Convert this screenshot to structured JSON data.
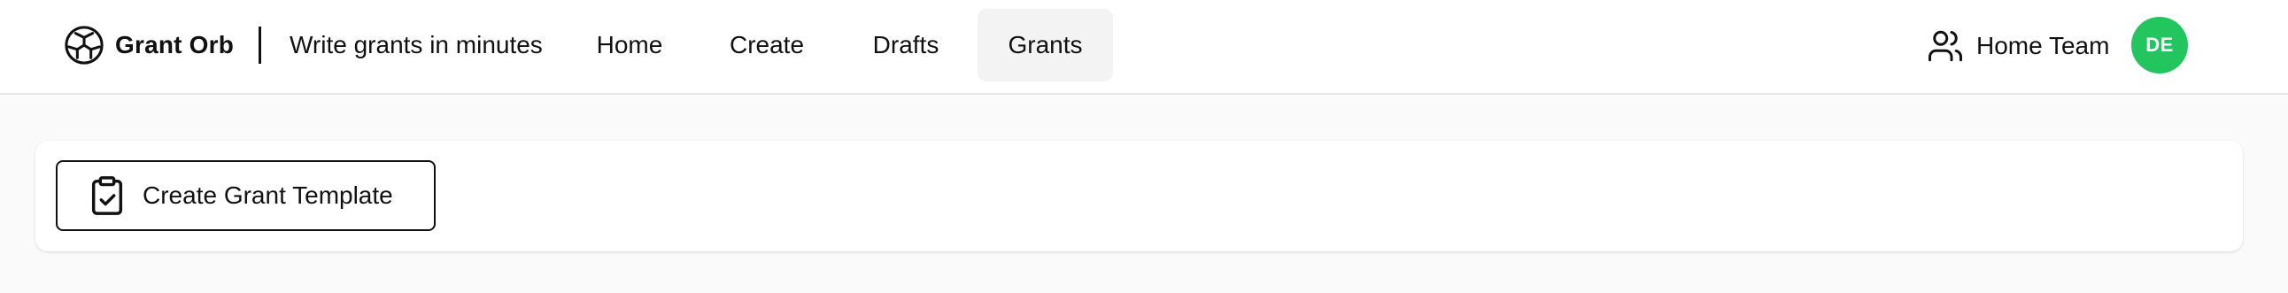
{
  "header": {
    "brand_name": "Grant Orb",
    "tagline": "Write grants in minutes",
    "nav": [
      {
        "label": "Home"
      },
      {
        "label": "Create"
      },
      {
        "label": "Drafts"
      },
      {
        "label": "Grants",
        "active": true
      }
    ],
    "team_name": "Home Team",
    "avatar_initials": "DE",
    "avatar_color": "#22c55e"
  },
  "main": {
    "create_template_label": "Create Grant Template"
  },
  "icons": {
    "brand": "orb-logo-icon",
    "team": "users-icon",
    "create_template": "clipboard-check-icon"
  }
}
